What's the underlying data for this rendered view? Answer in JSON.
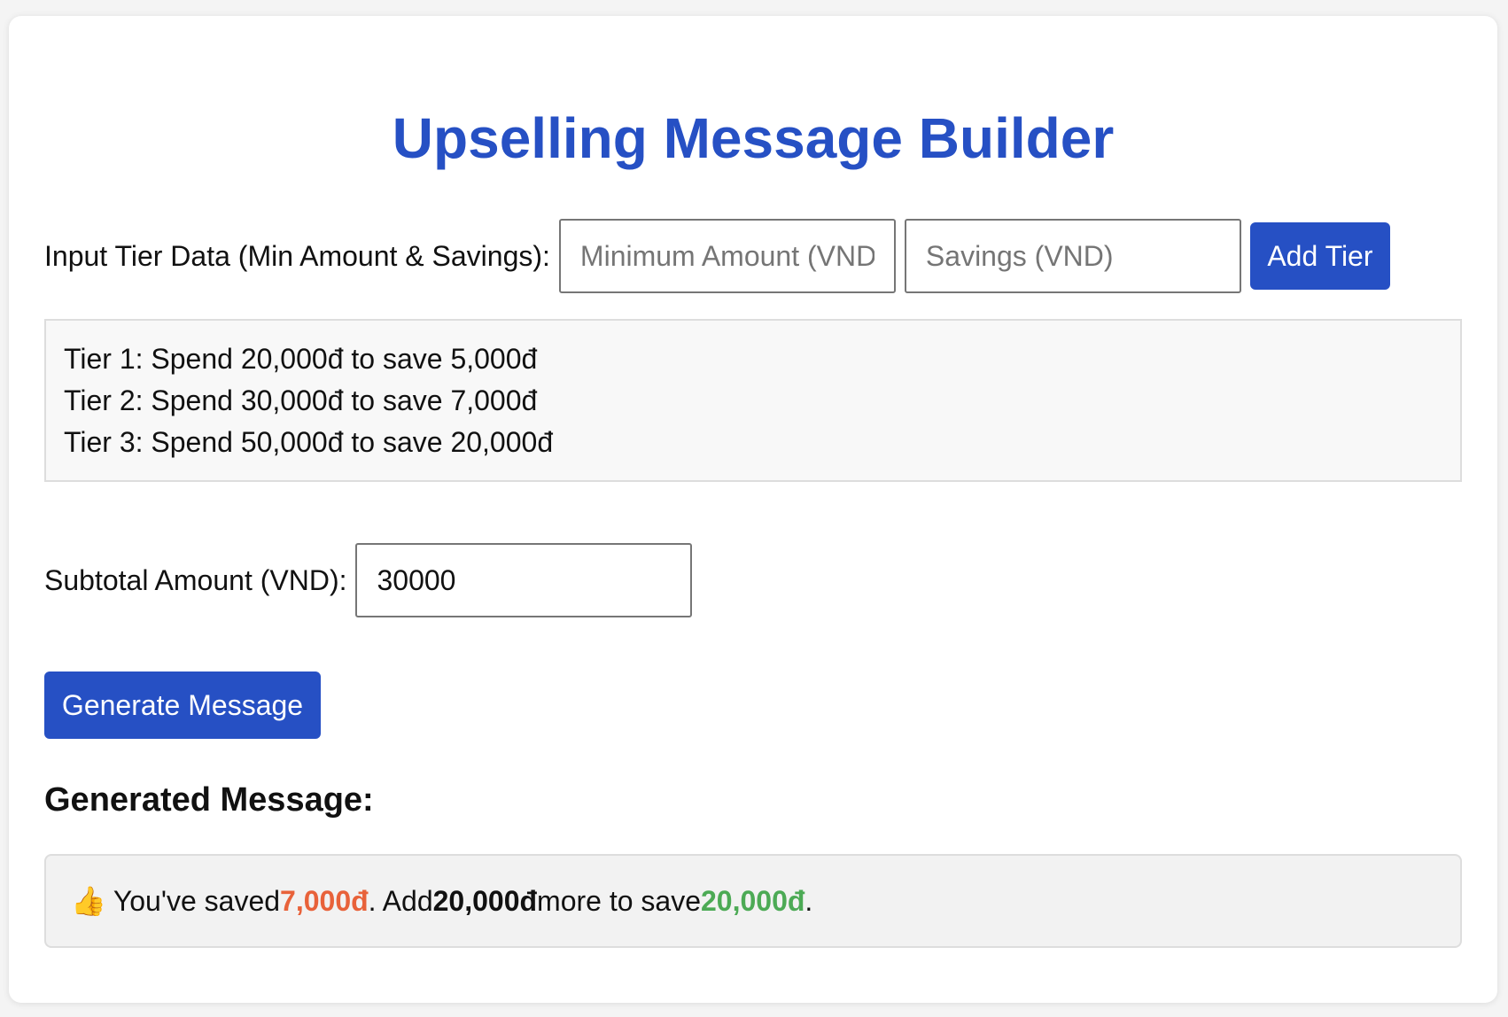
{
  "app": {
    "title": "Upselling Message Builder"
  },
  "tier_input": {
    "label": "Input Tier Data (Min Amount & Savings):",
    "min_amount_placeholder": "Minimum Amount (VND)",
    "savings_placeholder": "Savings (VND)",
    "add_button_label": "Add Tier"
  },
  "tiers": [
    "Tier 1: Spend 20,000đ to save 5,000đ",
    "Tier 2: Spend 30,000đ to save 7,000đ",
    "Tier 3: Spend 50,000đ to save 20,000đ"
  ],
  "subtotal": {
    "label": "Subtotal Amount (VND):",
    "value": "30000"
  },
  "generate_button_label": "Generate Message",
  "generated": {
    "heading": "Generated Message:",
    "emoji": "👍",
    "part1": "You've saved ",
    "saved_amount": "7,000đ",
    "part2": ". Add ",
    "more_amount": "20,000đ",
    "part3": " more to save ",
    "next_savings": "20,000đ",
    "part4": "."
  },
  "colors": {
    "accent": "#2650c4",
    "saved": "#e8623a",
    "next_savings": "#4caa55"
  }
}
